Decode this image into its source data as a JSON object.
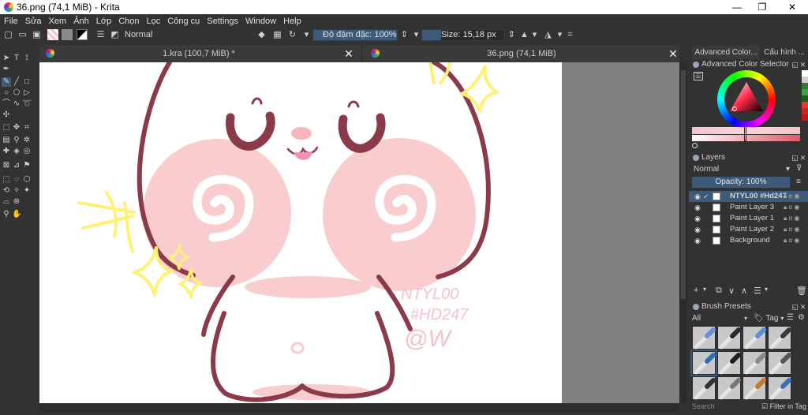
{
  "window": {
    "title": "36.png (74,1 MiB)  - Krita",
    "controls": [
      "—",
      "❐",
      "✕"
    ]
  },
  "menu": [
    {
      "label": "File"
    },
    {
      "label": "Sửa"
    },
    {
      "label": "Xem"
    },
    {
      "label": "Ảnh"
    },
    {
      "label": "Lớp"
    },
    {
      "label": "Chọn"
    },
    {
      "label": "Lọc"
    },
    {
      "label": "Công cụ"
    },
    {
      "label": "Settings"
    },
    {
      "label": "Window"
    },
    {
      "label": "Help"
    }
  ],
  "toolbar": {
    "blend_mode": "Normal",
    "opacity_label": "Độ đậm đặc: 100%",
    "opacity_value": 100,
    "size_label": "Size: 15,18 px",
    "size_value": 15.18
  },
  "tabs": [
    {
      "label": "1.kra (100,7 MiB) *",
      "close": "✕"
    },
    {
      "label": "36.png (74,1 MiB)",
      "close": "✕"
    }
  ],
  "canvas": {
    "watermark_line1": "NTYL00",
    "watermark_line2": "#HD247",
    "watermark_line3": "@W"
  },
  "dock": {
    "tabs": [
      "Advanced Color...",
      "Cấu hình ..."
    ],
    "color_selector_title": "Advanced Color Selector",
    "layers_title": "Layers",
    "layers_blend": "Normal",
    "layers_opacity": "Opacity:  100%",
    "layers": [
      {
        "name": "NTYL00 #Hd247",
        "selected": true
      },
      {
        "name": "Paint Layer 3",
        "selected": false
      },
      {
        "name": "Paint Layer 1",
        "selected": false
      },
      {
        "name": "Paint Layer 2",
        "selected": false
      },
      {
        "name": "Background",
        "selected": false
      }
    ],
    "brush_title": "Brush Presets",
    "brush_filter": "All",
    "brush_tag": "Tag",
    "search_placeholder": "Search",
    "filter_in_tag": "Filter in Tag"
  },
  "colors": {
    "accent": "#3d5a7a",
    "outline": "#8a3a48",
    "cheek": "#f9cccd",
    "star": "#fff176"
  }
}
